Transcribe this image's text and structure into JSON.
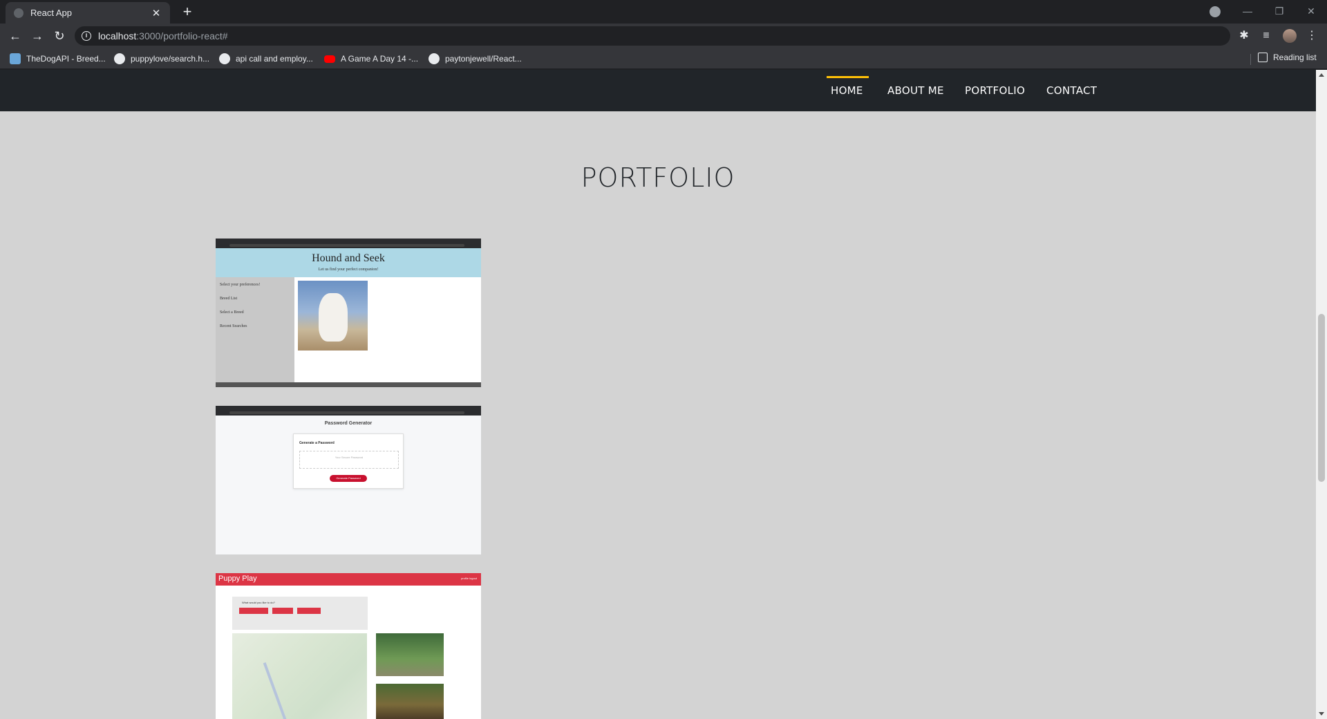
{
  "browser": {
    "tab_title": "React App",
    "url_host": "localhost",
    "url_path": ":3000/portfolio-react#",
    "bookmarks": [
      "TheDogAPI - Breed...",
      "puppylove/search.h...",
      "api call and employ...",
      "A Game A Day 14 -...",
      "paytonjewell/React..."
    ],
    "reading_list": "Reading list"
  },
  "nav": {
    "links": [
      "HOME",
      "ABOUT ME",
      "PORTFOLIO",
      "CONTACT"
    ],
    "active": "HOME",
    "accent_color": "#ffc107",
    "background": "#212529"
  },
  "page": {
    "heading": "PORTFOLIO",
    "background": "#d3d3d3"
  },
  "projects": [
    {
      "title": "Hound and Seek",
      "subtitle": "Let us find your perfect companion!",
      "sidebar": [
        "Select your preferences!",
        "Breed List",
        "Select a Breed",
        "Recent Searches"
      ]
    },
    {
      "title": "Password Generator",
      "box_title": "Generate a Password",
      "placeholder": "Your Secure Password",
      "button": "Generate Password"
    },
    {
      "title": "Puppy Play",
      "nav_right": "profile    logout",
      "question": "What would you like to do?"
    }
  ]
}
